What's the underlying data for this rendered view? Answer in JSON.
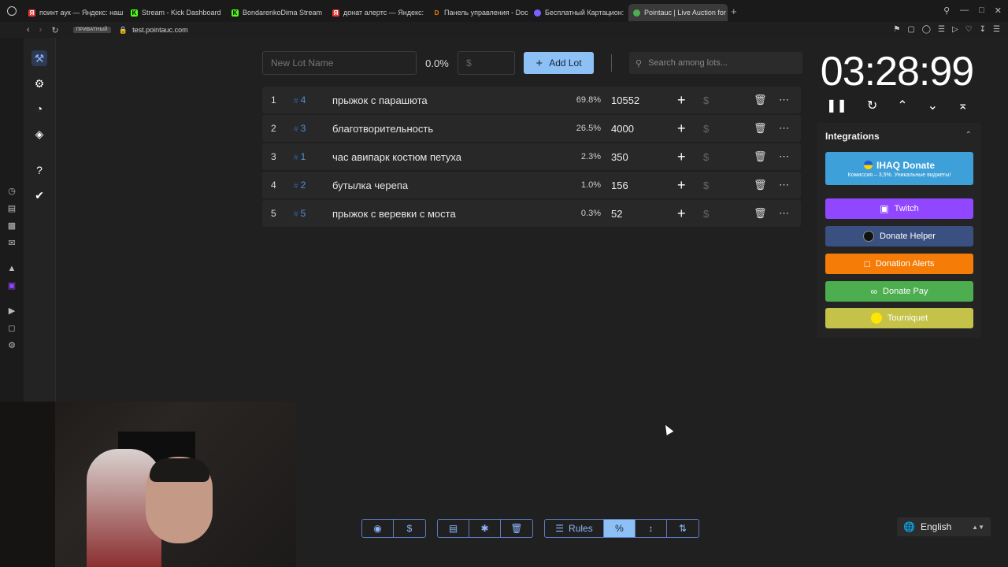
{
  "browser": {
    "tabs": [
      {
        "label": "поинт аук — Яндекс: наш",
        "color": "#e53935",
        "glyph": "Я"
      },
      {
        "label": "Stream - Kick Dashboard",
        "color": "#53fc18",
        "glyph": "K"
      },
      {
        "label": "BondarenkoDima Stream",
        "color": "#53fc18",
        "glyph": "K"
      },
      {
        "label": "донат алертс — Яндекс:",
        "color": "#e53935",
        "glyph": "Я"
      },
      {
        "label": "Панель управления - Doc",
        "color": "#f57d07",
        "glyph": "D"
      },
      {
        "label": "Бесплатный Картацион: ",
        "color": "#7b61ff",
        "glyph": "●"
      },
      {
        "label": "Pointauc | Live Auction for",
        "color": "#4caf50",
        "glyph": "●"
      }
    ],
    "private_label": "ПРИВАТНЫЙ",
    "url": "test.pointauc.com"
  },
  "toolbar": {
    "lot_name_placeholder": "New Lot Name",
    "total_percent": "0.0%",
    "amount_placeholder": "$",
    "add_lot_label": "Add Lot",
    "search_placeholder": "Search among lots..."
  },
  "lots": [
    {
      "index": "1",
      "id": "4",
      "name": "прыжок с парашюта",
      "percent": "69.8%",
      "amount": "10552"
    },
    {
      "index": "2",
      "id": "3",
      "name": "благотворительность",
      "percent": "26.5%",
      "amount": "4000"
    },
    {
      "index": "3",
      "id": "1",
      "name": "час авипарк костюм петуха",
      "percent": "2.3%",
      "amount": "350"
    },
    {
      "index": "4",
      "id": "2",
      "name": "бутылка черепа",
      "percent": "1.0%",
      "amount": "156"
    },
    {
      "index": "5",
      "id": "5",
      "name": "прыжок с веревки с моста",
      "percent": "0.3%",
      "amount": "52"
    }
  ],
  "timer": {
    "value": "03:28:99"
  },
  "integrations": {
    "title": "Integrations",
    "ihaq": {
      "label": "IHAQ Donate",
      "subtitle": "Комиссия – 3,5%. Уникальные виджеты!",
      "color": "#3ea0d9"
    },
    "buttons": [
      {
        "label": "Twitch",
        "color": "#9146ff",
        "icon": "twitch-icon"
      },
      {
        "label": "Donate Helper",
        "color": "#3a5080",
        "icon": "donate-helper-icon"
      },
      {
        "label": "Donation Alerts",
        "color": "#f57d07",
        "icon": "donation-alerts-icon"
      },
      {
        "label": "Donate Pay",
        "color": "#4cae4f",
        "icon": "donate-pay-icon"
      },
      {
        "label": "Tourniquet",
        "color": "#c5c24a",
        "icon": "tourniquet-icon"
      }
    ]
  },
  "bottom": {
    "rules_label": "Rules"
  },
  "language": {
    "selected": "English"
  }
}
